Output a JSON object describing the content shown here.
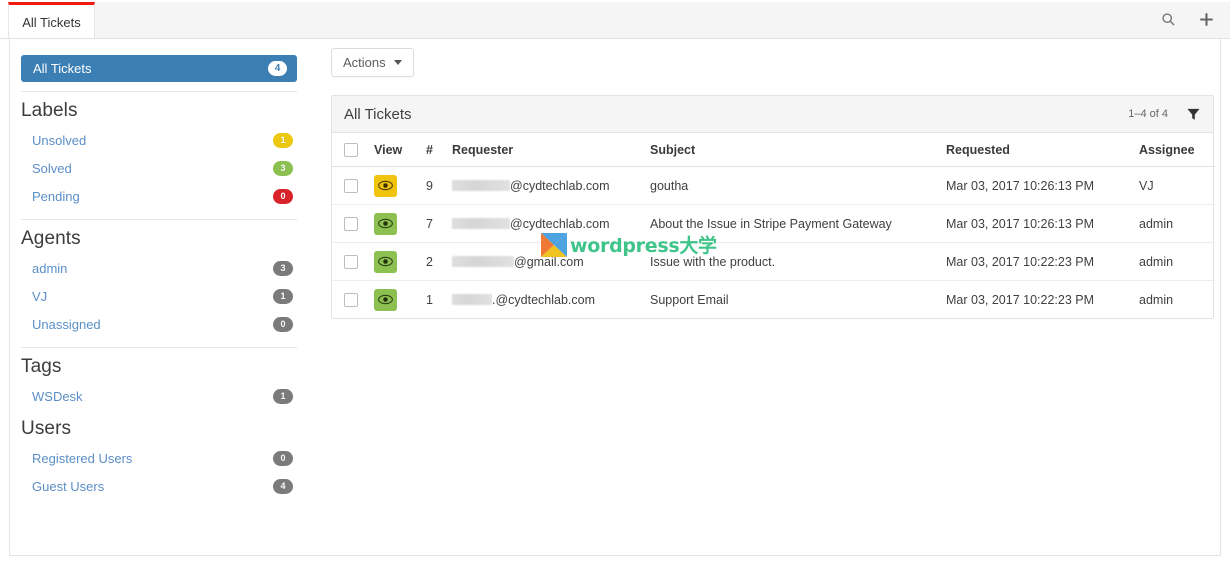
{
  "tabbar": {
    "active_tab": "All Tickets",
    "search_icon": "search-icon",
    "add_icon": "plus-icon"
  },
  "sidebar": {
    "primary": {
      "label": "All Tickets",
      "count": "4"
    },
    "sections": [
      {
        "heading": "Labels",
        "items": [
          {
            "label": "Unsolved",
            "count": "1",
            "color": "#ecc80e"
          },
          {
            "label": "Solved",
            "count": "3",
            "color": "#8cc152"
          },
          {
            "label": "Pending",
            "count": "0",
            "color": "#d9232b"
          }
        ]
      },
      {
        "heading": "Agents",
        "items": [
          {
            "label": "admin",
            "count": "3",
            "color": "#7b7b7b"
          },
          {
            "label": "VJ",
            "count": "1",
            "color": "#7b7b7b"
          },
          {
            "label": "Unassigned",
            "count": "0",
            "color": "#7b7b7b"
          }
        ]
      },
      {
        "heading": "Tags",
        "items": [
          {
            "label": "WSDesk",
            "count": "1",
            "color": "#7b7b7b"
          }
        ]
      },
      {
        "heading": "Users",
        "items": [
          {
            "label": "Registered Users",
            "count": "0",
            "color": "#7b7b7b"
          },
          {
            "label": "Guest Users",
            "count": "4",
            "color": "#7b7b7b"
          }
        ]
      }
    ]
  },
  "main": {
    "actions_button": "Actions",
    "card_title": "All Tickets",
    "pagination": "1–4 of 4",
    "filter_icon": "funnel-icon",
    "columns": [
      "",
      "View",
      "#",
      "Requester",
      "Subject",
      "Requested",
      "Assignee"
    ],
    "rows": [
      {
        "view_icon": "eye-icon",
        "view_color": "#f0c40d",
        "number": "9",
        "requester_redacted_width": 58,
        "requester": "@cydtechlab.com",
        "subject": "goutha",
        "requested": "Mar 03, 2017 10:26:13 PM",
        "assignee": "VJ"
      },
      {
        "view_icon": "eye-icon",
        "view_color": "#8cc152",
        "number": "7",
        "requester_redacted_width": 58,
        "requester": "@cydtechlab.com",
        "subject": "About the Issue in Stripe Payment Gateway",
        "requested": "Mar 03, 2017 10:26:13 PM",
        "assignee": "admin"
      },
      {
        "view_icon": "eye-icon",
        "view_color": "#8cc152",
        "number": "2",
        "requester_redacted_width": 62,
        "requester": "@gmail.com",
        "subject": "Issue with the product.",
        "requested": "Mar 03, 2017 10:22:23 PM",
        "assignee": "admin"
      },
      {
        "view_icon": "eye-icon",
        "view_color": "#8cc152",
        "number": "1",
        "requester_redacted_width": 40,
        "requester": ".@cydtechlab.com",
        "subject": "Support Email",
        "requested": "Mar 03, 2017 10:22:23 PM",
        "assignee": "admin"
      }
    ]
  },
  "watermark": {
    "text": "wordpress大学",
    "logo": "x-logo"
  }
}
